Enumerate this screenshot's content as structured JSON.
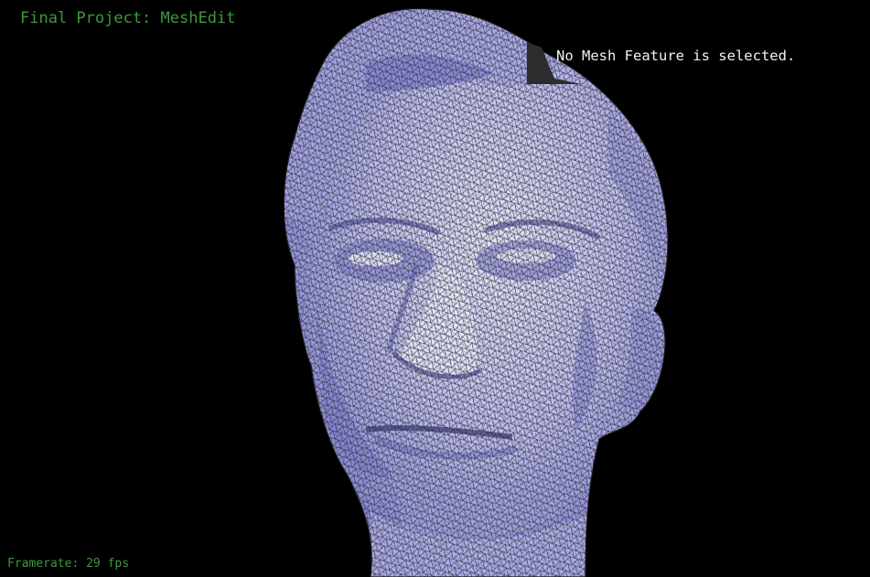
{
  "app": {
    "title": "Final Project: MeshEdit"
  },
  "status": {
    "message": "No Mesh Feature is selected."
  },
  "footer": {
    "framerate": "Framerate: 29 fps"
  },
  "colors": {
    "background": "#000000",
    "hud_text": "#3d9a3d",
    "mesh_fill": "#bdbdf2",
    "mesh_shade": "#7a7ae0",
    "wireframe": "#222222"
  },
  "icons": {
    "viewport": "mesh-head-render"
  }
}
